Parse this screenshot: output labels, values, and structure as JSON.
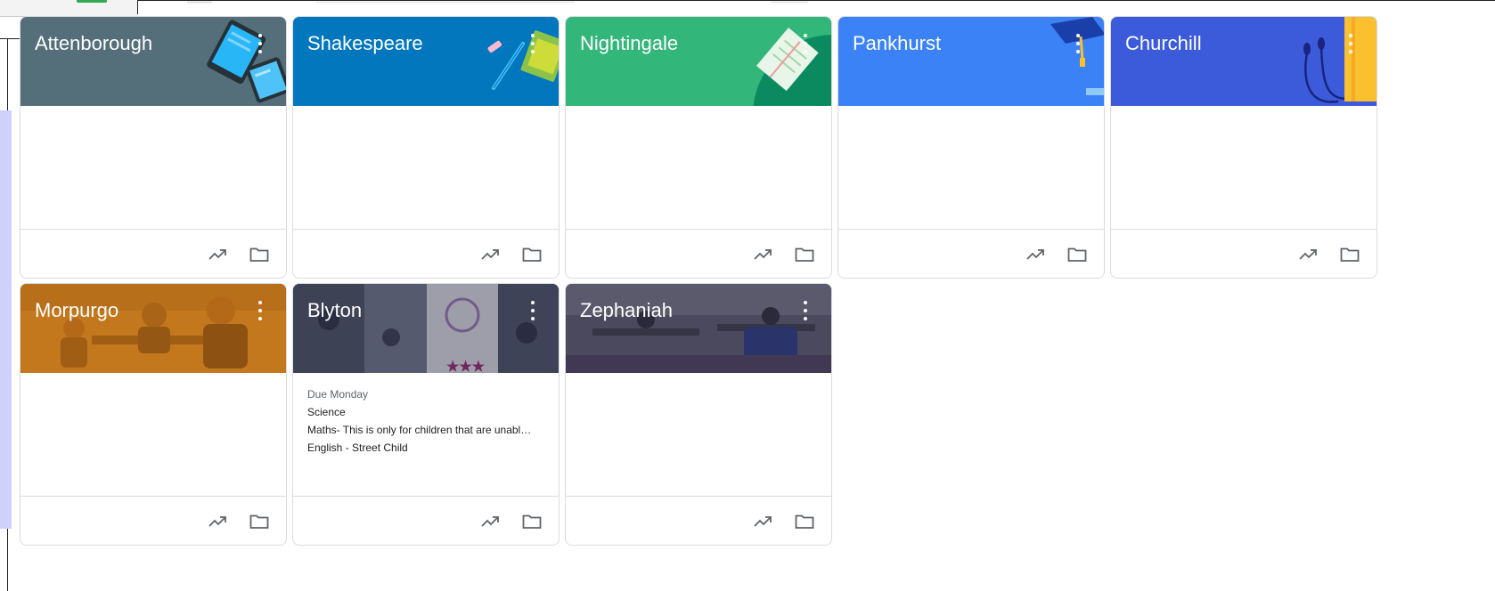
{
  "colors": {
    "attenborough": "#546e7a",
    "shakespeare": "#0277bd",
    "nightingale": "#33b679",
    "pankhurst": "#3b82f6",
    "churchill": "#3b5bdb",
    "morpurgo": "#c8781e",
    "blyton": "#5b5e72",
    "zephaniah": "#4a4d66",
    "card_border": "#dadce0",
    "icon": "#5f6368"
  },
  "classes": [
    {
      "name": "Attenborough",
      "theme": "tablets"
    },
    {
      "name": "Shakespeare",
      "theme": "pens"
    },
    {
      "name": "Nightingale",
      "theme": "notebook"
    },
    {
      "name": "Pankhurst",
      "theme": "graduation-cap"
    },
    {
      "name": "Churchill",
      "theme": "headphones-book"
    },
    {
      "name": "Morpurgo",
      "theme": "classroom-photo"
    },
    {
      "name": "Blyton",
      "theme": "school-photo-collage",
      "due": {
        "label": "Due Monday",
        "items": [
          "Science",
          "Maths- This is only for children that are unabl…",
          "English - Street Child"
        ]
      }
    },
    {
      "name": "Zephaniah",
      "theme": "classroom-photo"
    }
  ],
  "icons": {
    "trend": "trending-up-icon",
    "folder": "folder-icon",
    "menu": "more-vert-icon"
  }
}
